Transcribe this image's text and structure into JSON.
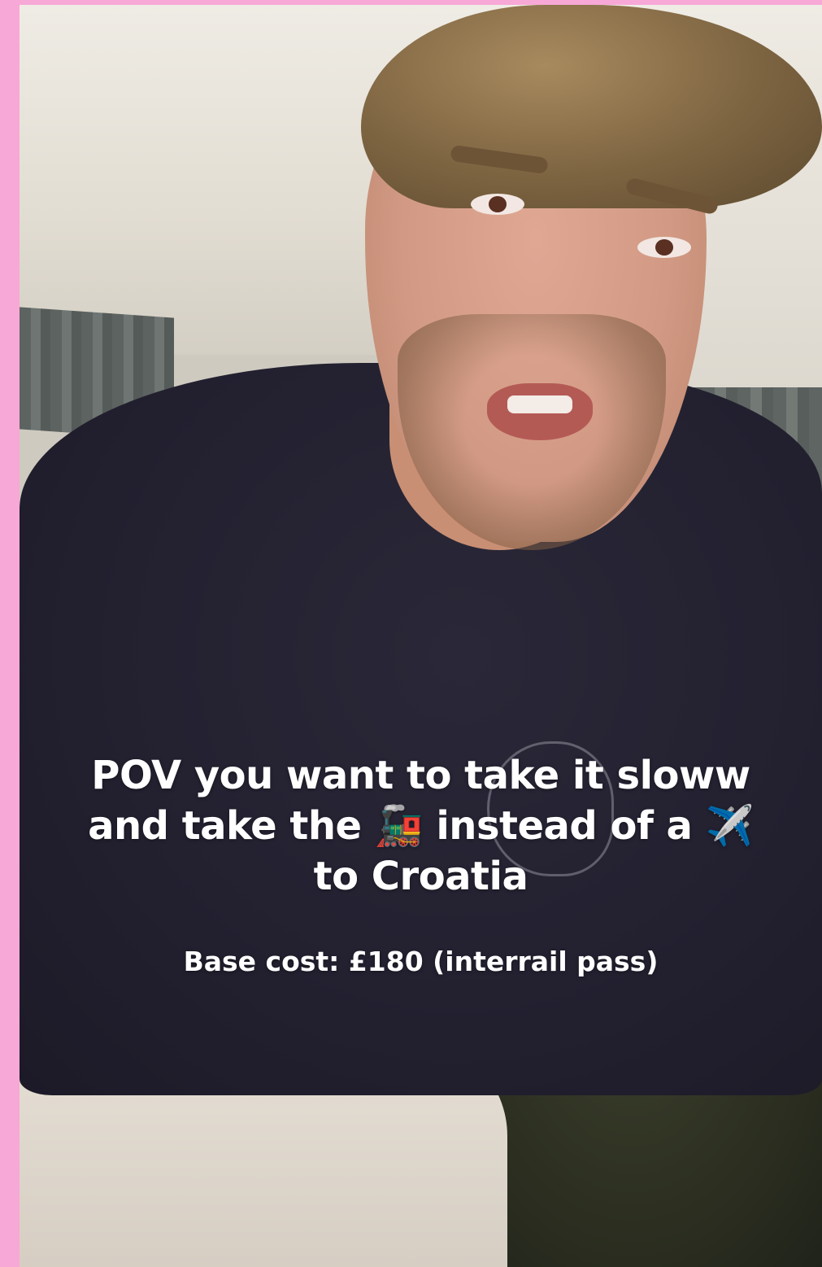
{
  "caption": {
    "line1": "POV you want to take it sloww",
    "line2_start": "and take the",
    "train_emoji": "🚂",
    "line2_mid": "instead of a",
    "plane_emoji": "✈️",
    "line3": "to Croatia"
  },
  "subcaption": "Base cost: £180 (interrail pass)",
  "colors": {
    "border": "#f7a8d6",
    "text": "#ffffff",
    "shirt": "#232130"
  },
  "icons": [
    "train-emoji",
    "airplane-emoji"
  ]
}
